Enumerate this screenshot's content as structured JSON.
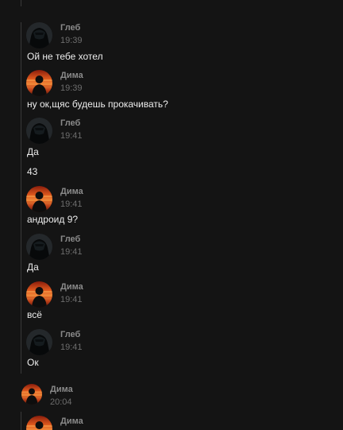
{
  "conversation": [
    {
      "author": "Глеб",
      "time": "19:39",
      "avatar": "dark-avatar",
      "texts": [
        "Ой не тебе хотел"
      ]
    },
    {
      "author": "Дима",
      "time": "19:39",
      "avatar": "sunset-avatar",
      "texts": [
        "ну ок,щяс будешь прокачивать?"
      ]
    },
    {
      "author": "Глеб",
      "time": "19:41",
      "avatar": "dark-avatar",
      "texts": [
        "Да",
        "43"
      ]
    },
    {
      "author": "Дима",
      "time": "19:41",
      "avatar": "sunset-avatar",
      "texts": [
        "андроид 9?"
      ]
    },
    {
      "author": "Глеб",
      "time": "19:41",
      "avatar": "dark-avatar",
      "texts": [
        "Да"
      ]
    },
    {
      "author": "Дима",
      "time": "19:41",
      "avatar": "sunset-avatar",
      "texts": [
        "всё"
      ]
    },
    {
      "author": "Глеб",
      "time": "19:41",
      "avatar": "dark-avatar",
      "texts": [
        "Ок"
      ]
    },
    {
      "author": "Дима",
      "time": "20:04",
      "avatar": "sunset-avatar",
      "texts": []
    },
    {
      "author": "Дима",
      "time": "",
      "avatar": "sunset-avatar",
      "texts": []
    }
  ],
  "colors": {
    "background": "#141414",
    "thread_line": "#3a3a3a",
    "author": "#8a8a8a",
    "timestamp": "#6d6d6d",
    "message_text": "#ececec"
  }
}
